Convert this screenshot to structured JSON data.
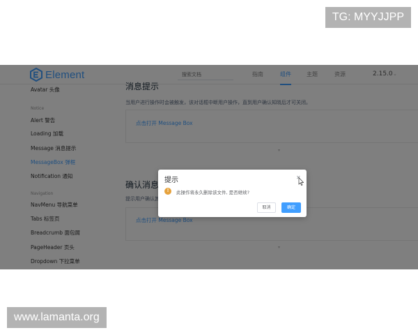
{
  "watermarks": {
    "top": "TG: MYYJJPP",
    "bottom": "www.lamanta.org"
  },
  "header": {
    "logo_text": "Element",
    "search_placeholder": "搜索文档",
    "nav": [
      "指南",
      "组件",
      "主题",
      "资源"
    ],
    "active_nav": "组件",
    "version": "2.15.0"
  },
  "sidebar": {
    "items": [
      {
        "label": "Avatar 头像",
        "type": "item"
      },
      {
        "label": "Notice",
        "type": "group"
      },
      {
        "label": "Alert 警告",
        "type": "item"
      },
      {
        "label": "Loading 加载",
        "type": "item"
      },
      {
        "label": "Message 消息提示",
        "type": "item"
      },
      {
        "label": "MessageBox 弹框",
        "type": "item",
        "active": true
      },
      {
        "label": "Notification 通知",
        "type": "item"
      },
      {
        "label": "Navigation",
        "type": "group"
      },
      {
        "label": "NavMenu 导航菜单",
        "type": "item"
      },
      {
        "label": "Tabs 标签页",
        "type": "item"
      },
      {
        "label": "Breadcrumb 面包屑",
        "type": "item"
      },
      {
        "label": "PageHeader 页头",
        "type": "item"
      },
      {
        "label": "Dropdown 下拉菜单",
        "type": "item"
      }
    ]
  },
  "content": {
    "section1_title": "消息提示",
    "section1_desc": "当用户进行操作时会被触发，该对话框中断用户操作，直到用户确认知晓后才可关闭。",
    "section1_button": "点击打开 Message Box",
    "section2_title": "确认消息",
    "section2_desc": "提示用户确认其已经触发的动作，并询问是否进行此操作时会用到此方法。",
    "section2_button": "点击打开 Message Box"
  },
  "dialog": {
    "title": "提示",
    "warning_glyph": "!",
    "message": "此操作将永久删除该文件, 是否继续?",
    "cancel_label": "取消",
    "confirm_label": "确定"
  },
  "colors": {
    "brand": "#409eff",
    "warning": "#e6a23c"
  }
}
